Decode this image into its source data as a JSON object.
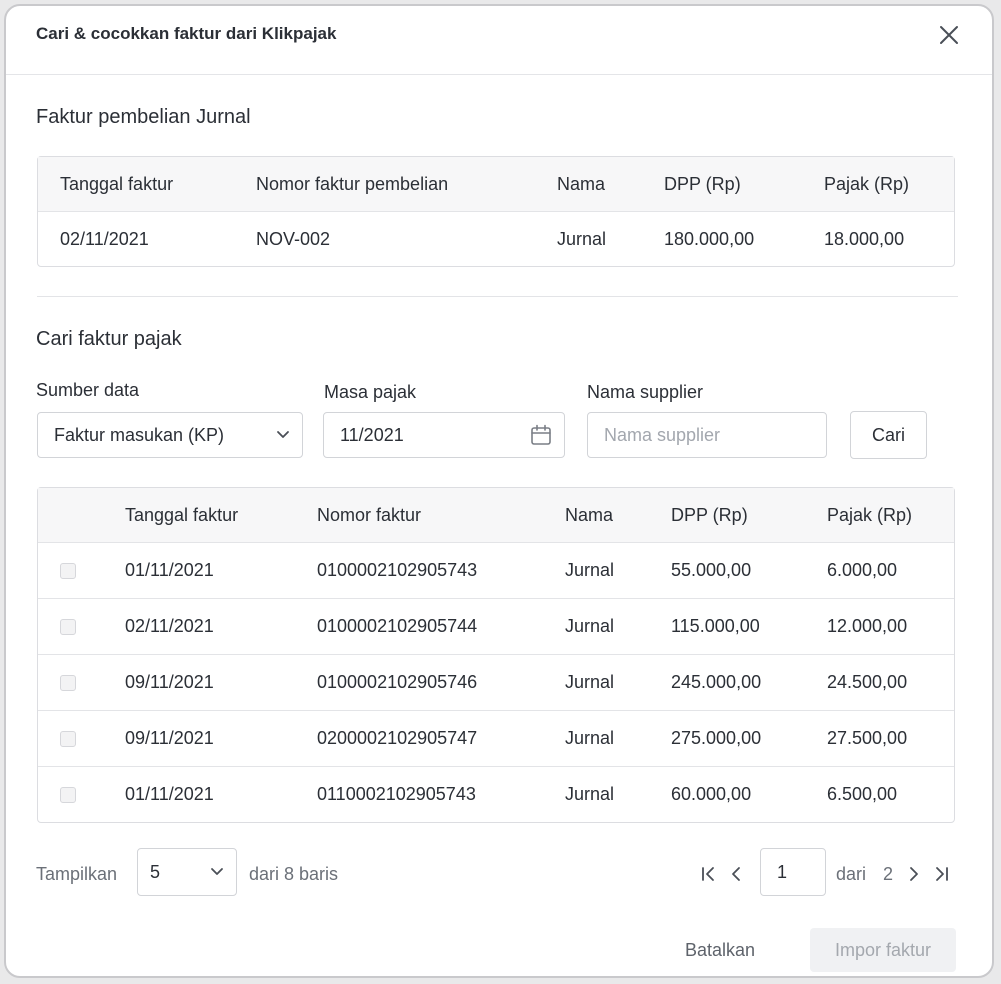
{
  "modal": {
    "title": "Cari & cocokkan faktur dari Klikpajak"
  },
  "purchase_section": {
    "title": "Faktur pembelian Jurnal",
    "columns": [
      "Tanggal faktur",
      "Nomor faktur pembelian",
      "Nama",
      "DPP (Rp)",
      "Pajak (Rp)"
    ],
    "row": [
      "02/11/2021",
      "NOV-002",
      "Jurnal",
      "180.000,00",
      "18.000,00"
    ]
  },
  "search_section": {
    "title": "Cari faktur pajak",
    "source_label": "Sumber data",
    "source_value": "Faktur masukan (KP)",
    "period_label": "Masa pajak",
    "period_value": "11/2021",
    "supplier_label": "Nama supplier",
    "supplier_placeholder": "Nama supplier",
    "search_button": "Cari"
  },
  "results": {
    "columns": [
      "Tanggal faktur",
      "Nomor faktur",
      "Nama",
      "DPP (Rp)",
      "Pajak (Rp)"
    ],
    "rows": [
      [
        "01/11/2021",
        "0100002102905743",
        "Jurnal",
        "55.000,00",
        "6.000,00"
      ],
      [
        "02/11/2021",
        "0100002102905744",
        "Jurnal",
        "115.000,00",
        "12.000,00"
      ],
      [
        "09/11/2021",
        "0100002102905746",
        "Jurnal",
        "245.000,00",
        "24.500,00"
      ],
      [
        "09/11/2021",
        "0200002102905747",
        "Jurnal",
        "275.000,00",
        "27.500,00"
      ],
      [
        "01/11/2021",
        "0110002102905743",
        "Jurnal",
        "60.000,00",
        "6.500,00"
      ]
    ]
  },
  "pagination": {
    "show_label": "Tampilkan",
    "page_size": "5",
    "rows_text": "dari 8 baris",
    "current_page": "1",
    "of_label": "dari",
    "total_pages": "2"
  },
  "actions": {
    "cancel": "Batalkan",
    "import": "Impor faktur"
  }
}
